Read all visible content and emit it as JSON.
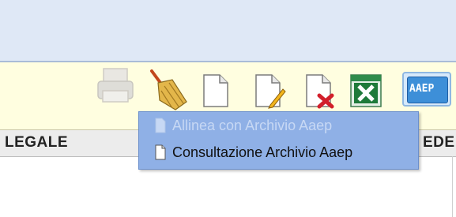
{
  "toolbar": {
    "icons": [
      "printer-icon",
      "broom-icon",
      "document-icon",
      "document-edit-icon",
      "document-delete-icon",
      "excel-icon",
      "aaep-icon"
    ],
    "aaep_label": "AAEP"
  },
  "table": {
    "header_left": "LEGALE",
    "header_right": "EDE"
  },
  "context_menu": {
    "items": [
      {
        "label": "Allinea con Archivio Aaep",
        "enabled": false,
        "icon": "document-icon"
      },
      {
        "label": "Consultazione Archivio Aaep",
        "enabled": true,
        "icon": "document-icon"
      }
    ]
  },
  "colors": {
    "top_band": "#dfe8f6",
    "toolbar": "#fffee0",
    "menu": "#8fb0e6",
    "excel_green": "#1e7a3a",
    "aaep_blue": "#3d8fd8"
  }
}
